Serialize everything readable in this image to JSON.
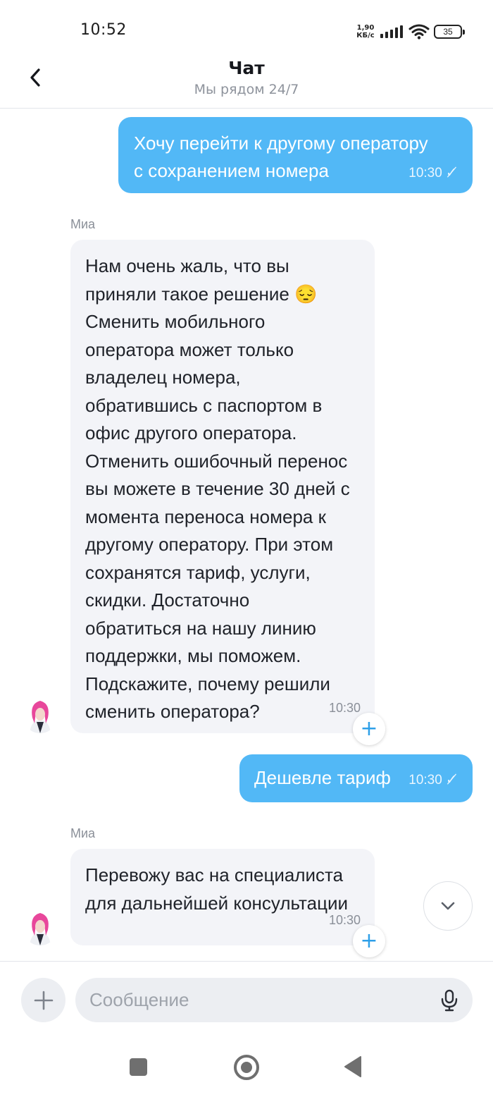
{
  "status_bar": {
    "time": "10:52",
    "net_speed_value": "1,90",
    "net_speed_unit": "КБ/с",
    "battery": "35",
    "signal_icon": "signal-bars-icon",
    "wifi_icon": "wifi-icon"
  },
  "header": {
    "title": "Чат",
    "subtitle": "Мы рядом 24/7",
    "back_icon": "chevron-left-icon"
  },
  "messages": [
    {
      "direction": "outgoing",
      "lines": [
        "Хочу перейти к другому оператору",
        "с сохранением номера"
      ],
      "time": "10:30",
      "status_icon": "double-check-icon"
    },
    {
      "direction": "incoming",
      "sender": "Миа",
      "lines": [
        "Нам очень жаль, что вы",
        "приняли такое решение 😔",
        "Сменить мобильного",
        "оператора может только",
        "владелец номера,",
        "обратившись с паспортом в",
        "офис другого оператора.",
        "Отменить ошибочный перенос",
        "вы можете в течение 30 дней с",
        "момента переноса номера к",
        "другому оператору. При этом",
        "сохранятся тариф, услуги,",
        "скидки. Достаточно",
        "обратиться на нашу линию",
        "поддержки, мы поможем.",
        "Подскажите, почему решили",
        "сменить оператора?"
      ],
      "time": "10:30"
    },
    {
      "direction": "outgoing",
      "lines": [
        "Дешевле тариф"
      ],
      "time": "10:30",
      "status_icon": "double-check-icon"
    },
    {
      "direction": "incoming",
      "sender": "Миа",
      "lines": [
        "Перевожу вас на специалиста",
        "для дальнейшей консультации"
      ],
      "time": "10:30"
    }
  ],
  "composer": {
    "placeholder": "Сообщение",
    "attach_icon": "plus-icon",
    "mic_icon": "microphone-icon"
  },
  "colors": {
    "outgoing_bubble": "#52b8f6",
    "incoming_bubble": "#f3f4f8",
    "accent": "#2e9fe8"
  }
}
